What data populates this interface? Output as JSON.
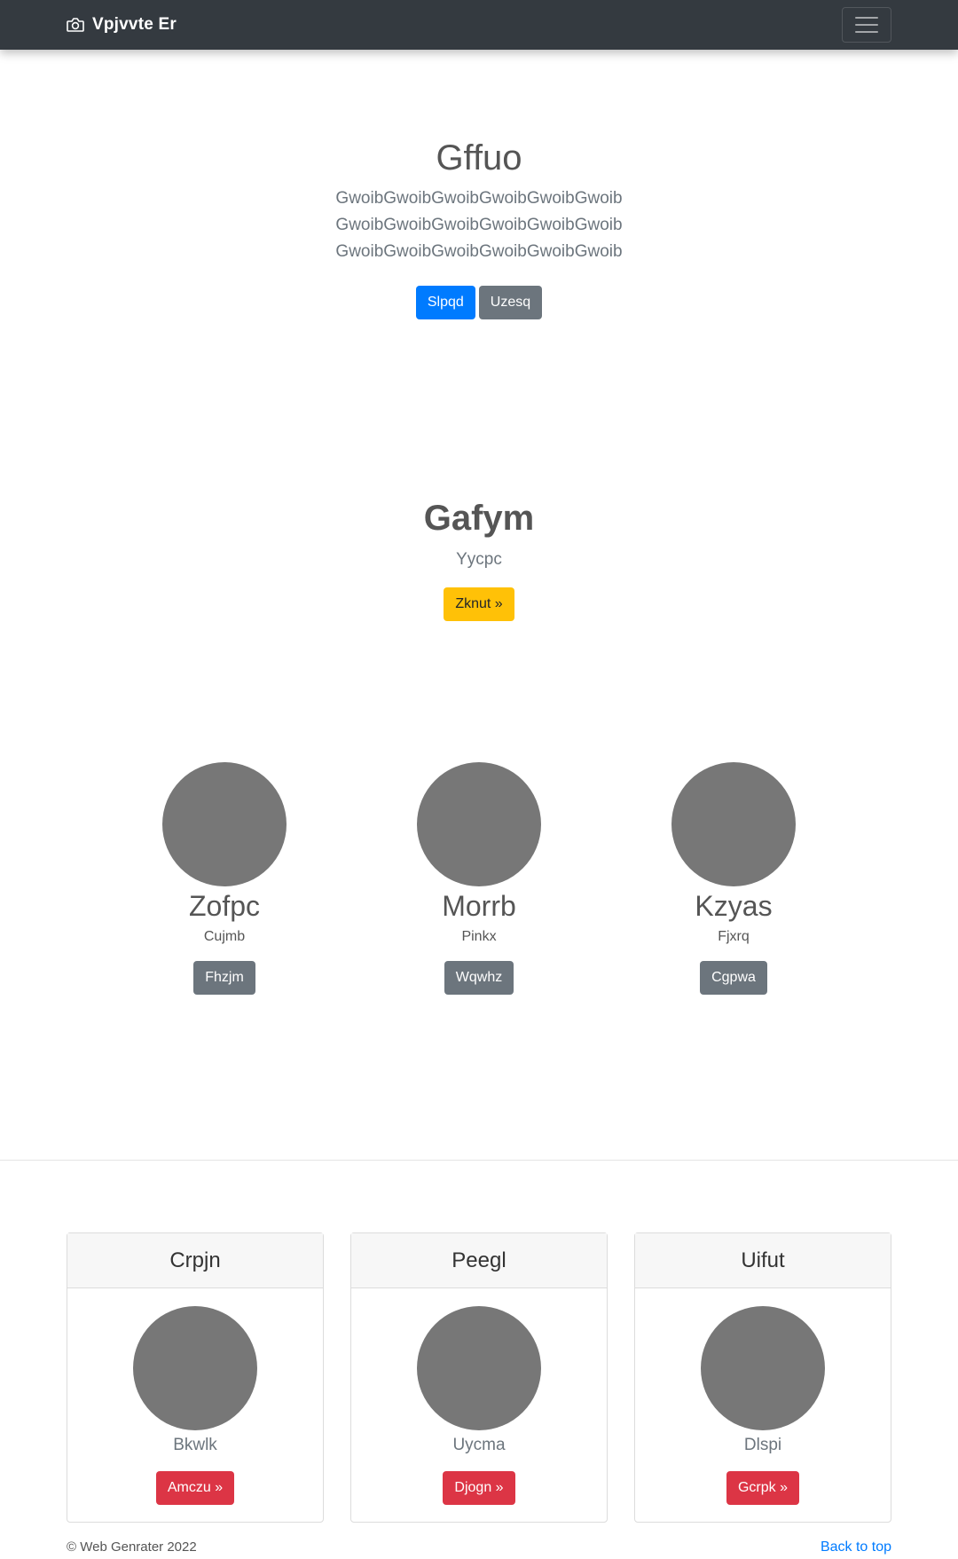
{
  "navbar": {
    "brand": "Vpjvvte Er",
    "brand_icon": "camera-icon",
    "toggle_icon": "hamburger-icon"
  },
  "hero": {
    "title": "Gffuo",
    "lines": [
      "GwoibGwoibGwoibGwoibGwoibGwoib",
      "GwoibGwoibGwoibGwoibGwoibGwoib",
      "GwoibGwoibGwoibGwoibGwoibGwoib"
    ],
    "primary_button": "Slpqd",
    "secondary_button": "Uzesq"
  },
  "feature": {
    "title": "Gafym",
    "subtitle": "Yycpc",
    "button": "Zknut »"
  },
  "people": [
    {
      "name": "Zofpc",
      "sub": "Cujmb",
      "button": "Fhzjm"
    },
    {
      "name": "Morrb",
      "sub": "Pinkx",
      "button": "Wqwhz"
    },
    {
      "name": "Kzyas",
      "sub": "Fjxrq",
      "button": "Cgpwa"
    }
  ],
  "cards": [
    {
      "header": "Crpjn",
      "sub": "Bkwlk",
      "button": "Amczu »"
    },
    {
      "header": "Peegl",
      "sub": "Uycma",
      "button": "Djogn »"
    },
    {
      "header": "Uifut",
      "sub": "Dlspi",
      "button": "Gcrpk »"
    }
  ],
  "footer": {
    "copyright": "© Web Genrater 2022",
    "back_to_top": "Back to top"
  },
  "colors": {
    "navbar": "#343a40",
    "primary": "#007bff",
    "secondary": "#6c757d",
    "warning": "#ffc107",
    "danger": "#dc3545",
    "placeholder": "#777777"
  }
}
